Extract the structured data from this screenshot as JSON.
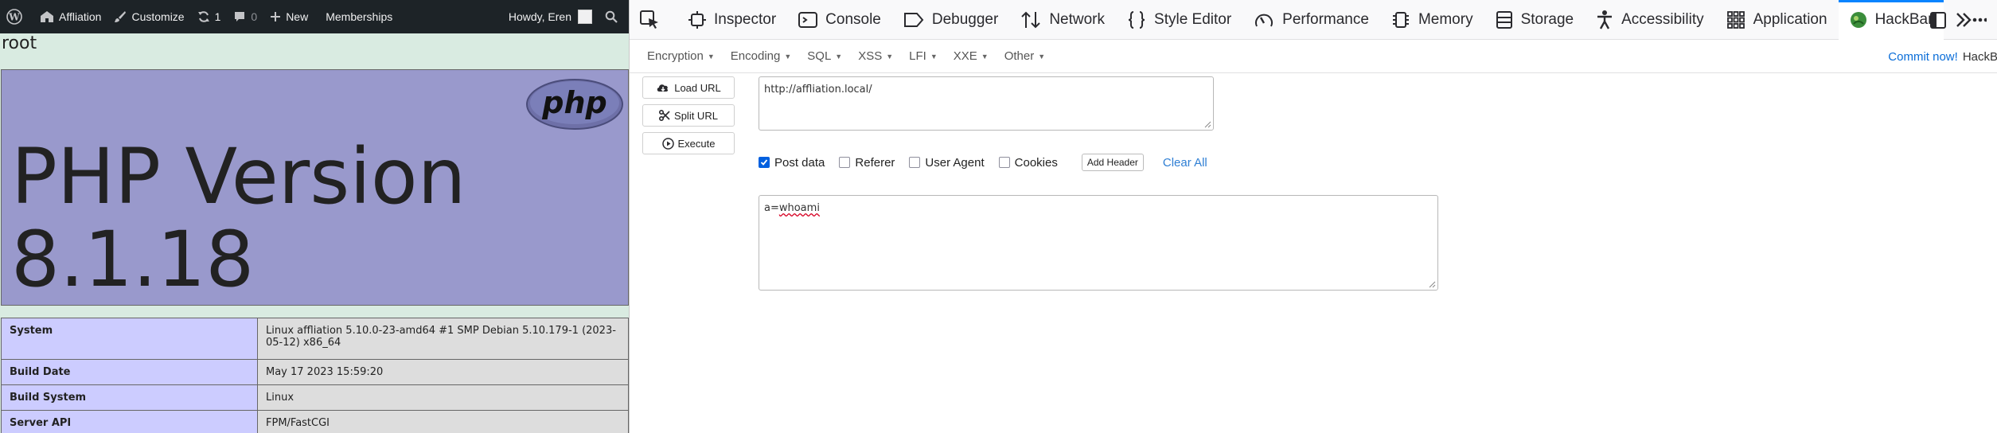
{
  "wpbar": {
    "site_name": "Affliation",
    "customize": "Customize",
    "updates_count": "1",
    "comments_count": "0",
    "new_label": "New",
    "memberships": "Memberships",
    "howdy": "Howdy, Eren"
  },
  "page": {
    "root_text": "root",
    "php_title": "PHP Version 8.1.18",
    "php_logo_text": "php"
  },
  "phpinfo": {
    "rows": [
      {
        "key": "System",
        "value": "Linux affliation 5.10.0-23-amd64 #1 SMP Debian 5.10.179-1 (2023-05-12) x86_64"
      },
      {
        "key": "Build Date",
        "value": "May 17 2023 15:59:20"
      },
      {
        "key": "Build System",
        "value": "Linux"
      },
      {
        "key": "Server API",
        "value": "FPM/FastCGI"
      }
    ]
  },
  "devtools": {
    "tabs": [
      "Inspector",
      "Console",
      "Debugger",
      "Network",
      "Style Editor",
      "Performance",
      "Memory",
      "Storage",
      "Accessibility",
      "Application",
      "HackBar"
    ],
    "active_tab": "HackBar",
    "more_icon": "chevron-double-right-icon"
  },
  "hackbar": {
    "menus": [
      "Encryption",
      "Encoding",
      "SQL",
      "XSS",
      "LFI",
      "XXE",
      "Other"
    ],
    "commit_link": "Commit now!",
    "commit_rest": "HackB",
    "load_url": "Load URL",
    "split_url": "Split URL",
    "execute": "Execute",
    "url_value": "http://affliation.local/",
    "post_data_label": "Post data",
    "post_data_checked": true,
    "referer_label": "Referer",
    "user_agent_label": "User Agent",
    "cookies_label": "Cookies",
    "add_header": "Add Header",
    "clear_all": "Clear All",
    "body_key": "a=",
    "body_value": "whoami"
  },
  "colors": {
    "php_purple": "#9999cc",
    "php_key_bg": "#ccccff",
    "php_val_bg": "#dddddd",
    "page_bg": "#d9ebe1",
    "wp_bar": "#1d2327",
    "accent_blue": "#0a84ff"
  }
}
